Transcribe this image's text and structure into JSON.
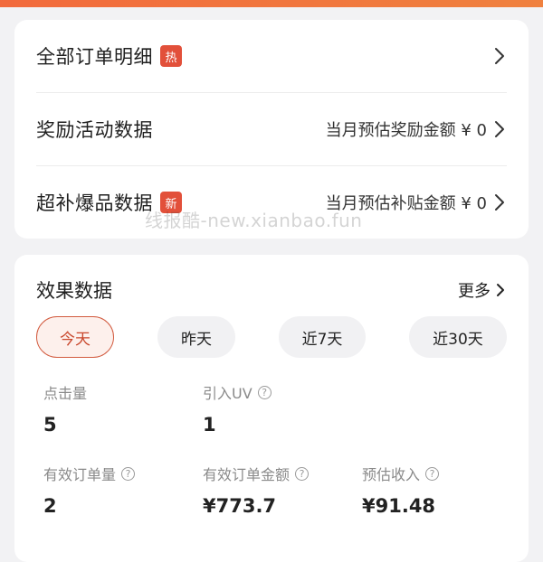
{
  "menu": {
    "items": [
      {
        "label": "全部订单明细",
        "badge": "热",
        "sub": ""
      },
      {
        "label": "奖励活动数据",
        "badge": "",
        "sub": "当月预估奖励金额 ¥ 0"
      },
      {
        "label": "超补爆品数据",
        "badge": "新",
        "sub": "当月预估补贴金额 ¥ 0"
      }
    ],
    "watermark": "线报酷-new.xianbao.fun"
  },
  "stats": {
    "title": "效果数据",
    "more_label": "更多",
    "filters": [
      "今天",
      "昨天",
      "近7天",
      "近30天"
    ],
    "active_filter": "今天",
    "metrics": [
      {
        "label": "点击量",
        "value": "5",
        "has_help": false
      },
      {
        "label": "引入UV",
        "value": "1",
        "has_help": true
      },
      {
        "label": "有效订单量",
        "value": "2",
        "has_help": true
      },
      {
        "label": "有效订单金额",
        "value": "¥773.7",
        "has_help": true
      },
      {
        "label": "预估收入",
        "value": "¥91.48",
        "has_help": true
      }
    ]
  },
  "icons": {
    "chevron": "chevron-right-icon",
    "help": "question-circle-icon"
  },
  "colors": {
    "accent": "#e2503a",
    "active_filter_border": "#d25a3e",
    "top_band": "#f26a3c"
  }
}
